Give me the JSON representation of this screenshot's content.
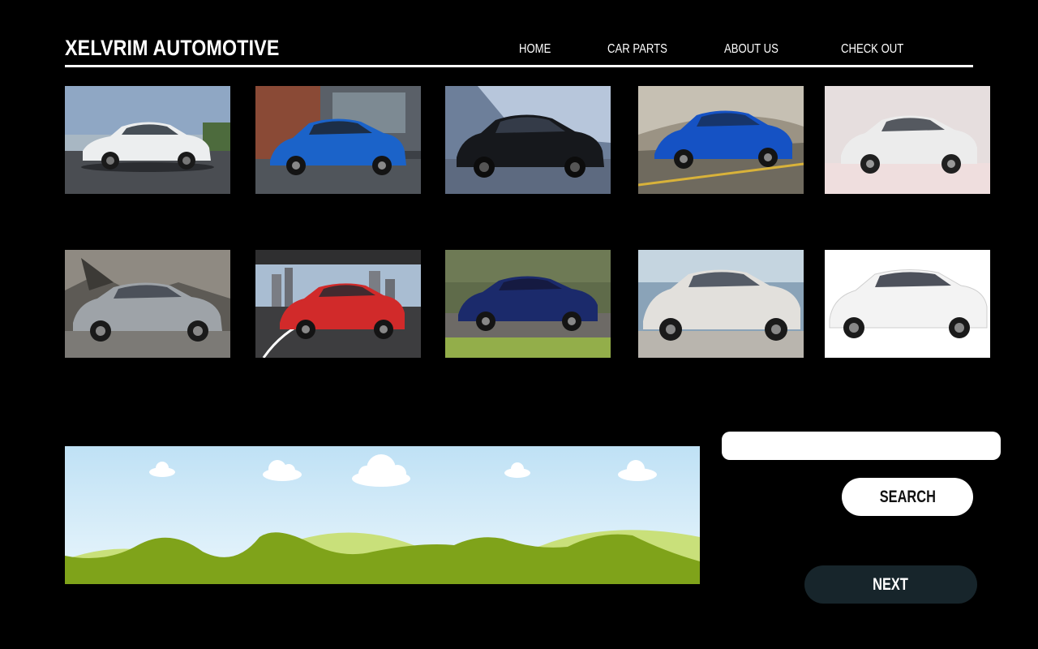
{
  "header": {
    "brand": "XELVRIM AUTOMOTIVE",
    "nav": [
      {
        "label": "HOME"
      },
      {
        "label": "CAR PARTS"
      },
      {
        "label": "ABOUT US"
      },
      {
        "label": "CHECK OUT"
      }
    ]
  },
  "gallery": {
    "cars": [
      {
        "body_color": "#eceeef",
        "scene": "waterfront road"
      },
      {
        "body_color": "#1b63c9",
        "scene": "city street"
      },
      {
        "body_color": "#16181c",
        "scene": "studio"
      },
      {
        "body_color": "#1552c4",
        "scene": "hillside road"
      },
      {
        "body_color": "#ececec",
        "scene": "studio"
      },
      {
        "body_color": "#9ea3a8",
        "scene": "rocky cliff"
      },
      {
        "body_color": "#d12a2a",
        "scene": "city bridge"
      },
      {
        "body_color": "#1b2a6b",
        "scene": "motion blur road"
      },
      {
        "body_color": "#e2e0dc",
        "scene": "building facade"
      },
      {
        "body_color": "#f3f3f3",
        "scene": "white background"
      }
    ]
  },
  "banner": {
    "sky_top": "#bfe1f5",
    "sky_bottom": "#eaf6fc",
    "hill_front": "#7fa31a",
    "hill_back": "#c9e07a"
  },
  "search": {
    "value": "",
    "placeholder": "",
    "button_label": "SEARCH"
  },
  "next_label": "NEXT",
  "colors": {
    "background": "#000000",
    "text": "#ffffff",
    "next_button": "#17252b"
  }
}
